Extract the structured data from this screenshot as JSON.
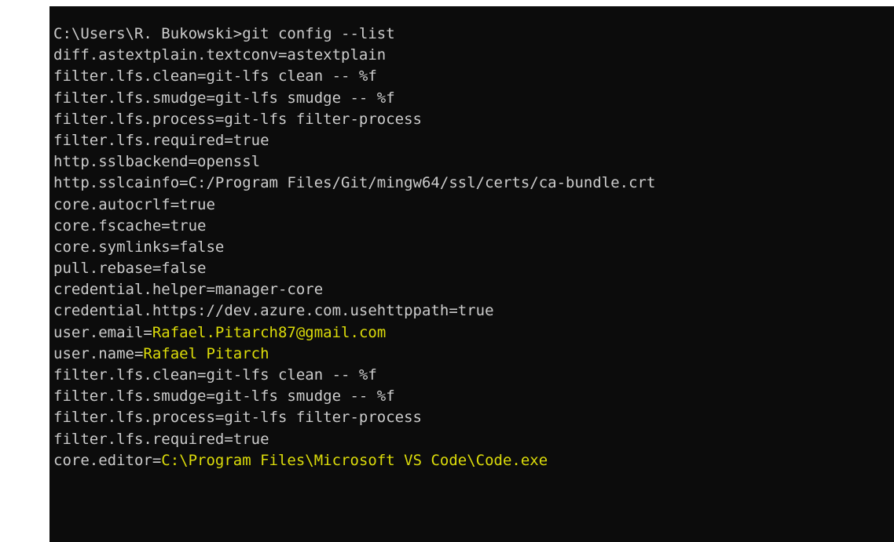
{
  "terminal": {
    "prompt": "C:\\Users\\R. Bukowski>",
    "command": "git config --list",
    "colors": {
      "background": "#0c0c0c",
      "text": "#cccccc",
      "highlight": "#dcdc0a"
    },
    "lines": [
      {
        "text": "diff.astextplain.textconv=astextplain"
      },
      {
        "text": "filter.lfs.clean=git-lfs clean -- %f"
      },
      {
        "text": "filter.lfs.smudge=git-lfs smudge -- %f"
      },
      {
        "text": "filter.lfs.process=git-lfs filter-process"
      },
      {
        "text": "filter.lfs.required=true"
      },
      {
        "text": "http.sslbackend=openssl"
      },
      {
        "text": "http.sslcainfo=C:/Program Files/Git/mingw64/ssl/certs/ca-bundle.crt"
      },
      {
        "text": "core.autocrlf=true"
      },
      {
        "text": "core.fscache=true"
      },
      {
        "text": "core.symlinks=false"
      },
      {
        "text": "pull.rebase=false"
      },
      {
        "text": "credential.helper=manager-core"
      },
      {
        "text": "credential.https://dev.azure.com.usehttppath=true"
      },
      {
        "key": "user.email=",
        "value": "Rafael.Pitarch87@gmail.com"
      },
      {
        "key": "user.name=",
        "value": "Rafael Pitarch"
      },
      {
        "text": "filter.lfs.clean=git-lfs clean -- %f"
      },
      {
        "text": "filter.lfs.smudge=git-lfs smudge -- %f"
      },
      {
        "text": "filter.lfs.process=git-lfs filter-process"
      },
      {
        "text": "filter.lfs.required=true"
      },
      {
        "key": "core.editor=",
        "value": "C:\\Program Files\\Microsoft VS Code\\Code.exe"
      }
    ]
  }
}
